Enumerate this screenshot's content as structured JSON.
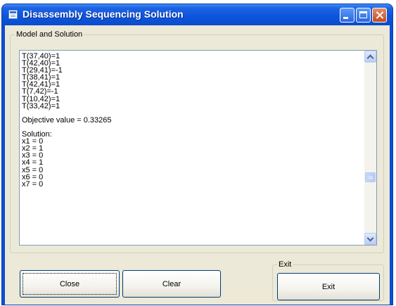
{
  "window": {
    "title": "Disassembly Sequencing Solution"
  },
  "model_group": {
    "label": "Model and Solution"
  },
  "textarea": {
    "lines": [
      "T(37,40)=1",
      "T(42,40)=1",
      "T(29,41)=-1",
      "T(38,41)=1",
      "T(42,41)=1",
      "T(7,42)=-1",
      "T(10,42)=1",
      "T(33,42)=1",
      "",
      "Objective value = 0.33265",
      "",
      "Solution:",
      "x1 = 0",
      "x2 = 1",
      "x3 = 0",
      "x4 = 1",
      "x5 = 0",
      "x6 = 0",
      "x7 = 0"
    ]
  },
  "buttons": {
    "close": "Close",
    "clear": "Clear",
    "exit": "Exit"
  },
  "exit_group": {
    "label": "Exit"
  },
  "colors": {
    "titlebar": "#0b4fd8",
    "client_background": "#ece9d8",
    "close_caption_button": "#c24a20"
  },
  "icons": {
    "window_icon": "application-window-icon",
    "minimize": "minimize-icon",
    "maximize": "maximize-icon",
    "close": "close-icon",
    "scroll_up": "chevron-up-icon",
    "scroll_down": "chevron-down-icon"
  }
}
